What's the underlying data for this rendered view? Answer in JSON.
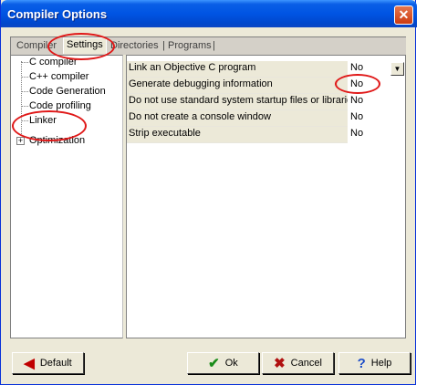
{
  "window": {
    "title": "Compiler Options",
    "close_glyph": "✕"
  },
  "tabs": [
    {
      "label": "Compiler"
    },
    {
      "label": "Settings"
    },
    {
      "label": "Directories"
    },
    {
      "label": "Programs"
    }
  ],
  "tab_separators": [
    "|",
    "|",
    "|"
  ],
  "tree": {
    "expander_glyph": "+",
    "items": [
      {
        "label": "C compiler"
      },
      {
        "label": "C++ compiler"
      },
      {
        "label": "Code Generation"
      },
      {
        "label": "Code profiling"
      },
      {
        "label": "Linker"
      },
      {
        "label": "Optimization"
      }
    ]
  },
  "properties": [
    {
      "name": "Link an Objective  C program",
      "value": "No"
    },
    {
      "name": "Generate debugging information",
      "value": "No"
    },
    {
      "name": "Do not use standard system startup files or libraries",
      "value": "No"
    },
    {
      "name": "Do not create a console window",
      "value": "No"
    },
    {
      "name": "Strip executable",
      "value": "No"
    }
  ],
  "dropdown_glyph": "▼",
  "buttons": {
    "default": {
      "label": "Default",
      "icon": "arrow-left-icon",
      "glyph": "◀"
    },
    "ok": {
      "label": "Ok",
      "icon": "check-icon",
      "glyph": "✔"
    },
    "cancel": {
      "label": "Cancel",
      "icon": "x-icon",
      "glyph": "✖"
    },
    "help": {
      "label": "Help",
      "icon": "help-icon",
      "glyph": "?"
    }
  },
  "colors": {
    "titlebar": "#0054e3",
    "annotation": "#e01818",
    "face": "#ece9d8"
  }
}
